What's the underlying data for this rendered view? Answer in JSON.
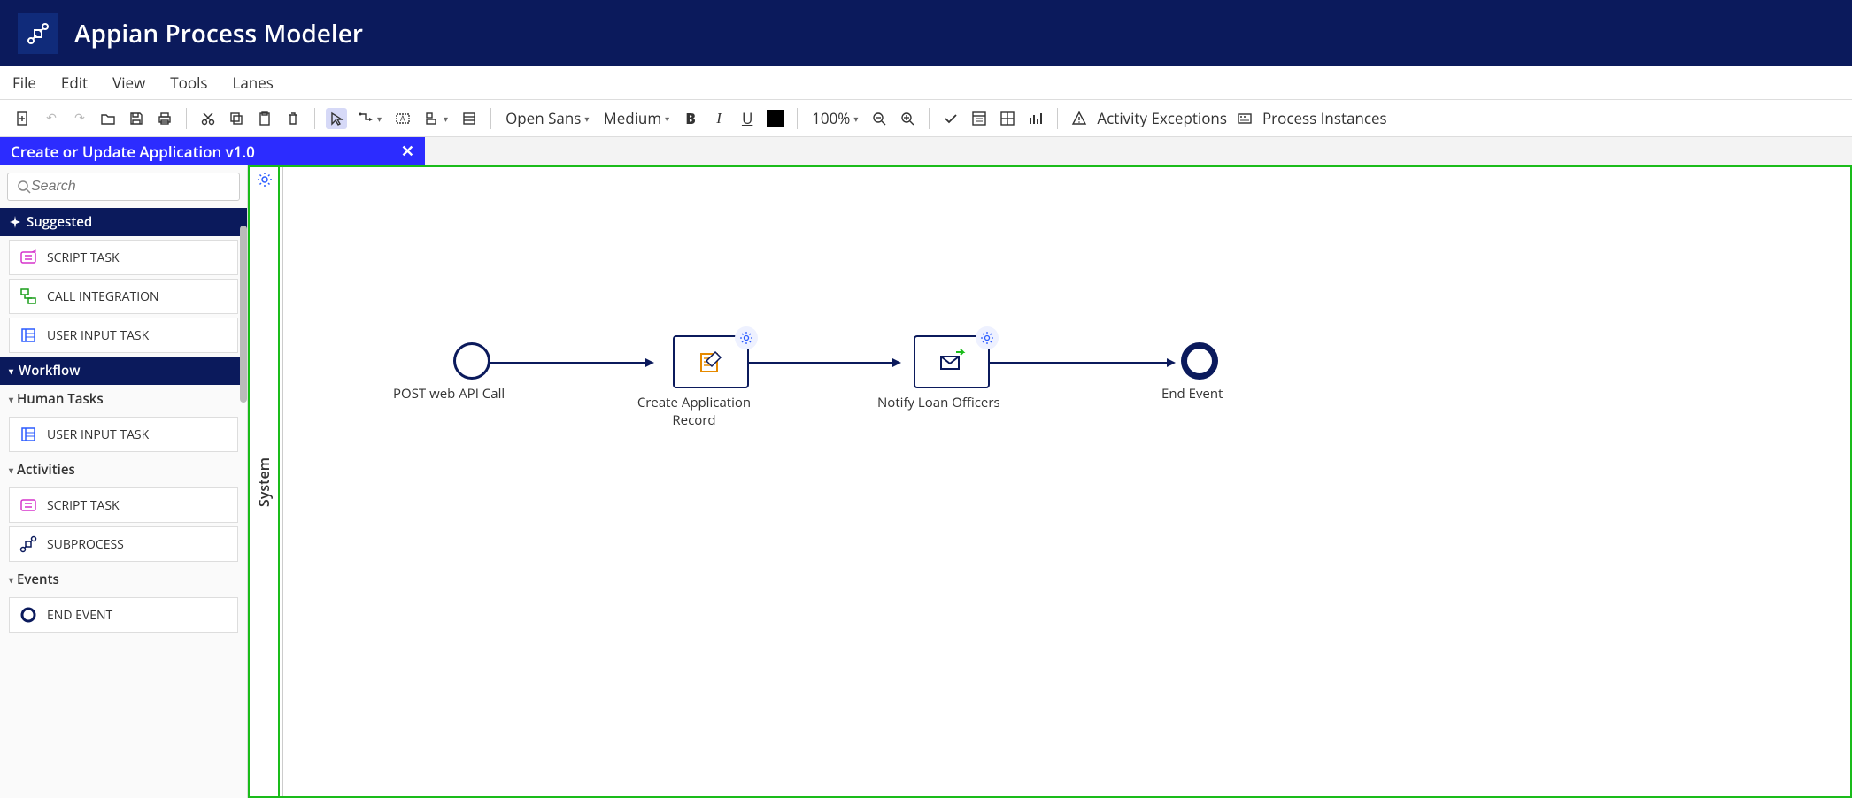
{
  "app_title": "Appian Process Modeler",
  "menu": [
    "File",
    "Edit",
    "View",
    "Tools",
    "Lanes"
  ],
  "toolbar": {
    "font_family": "Open Sans",
    "font_weight": "Medium",
    "zoom": "100%",
    "activity_exceptions": "Activity Exceptions",
    "process_instances": "Process Instances"
  },
  "tab_title": "Create or Update Application v1.0",
  "search_placeholder": "Search",
  "sidebar": {
    "suggested_label": "Suggested",
    "workflow_label": "Workflow",
    "suggested_items": [
      {
        "label": "SCRIPT TASK",
        "icon": "script"
      },
      {
        "label": "CALL INTEGRATION",
        "icon": "integration"
      },
      {
        "label": "USER INPUT TASK",
        "icon": "userinput"
      }
    ],
    "workflow_groups": [
      {
        "label": "Human Tasks",
        "items": [
          {
            "label": "USER INPUT TASK",
            "icon": "userinput"
          }
        ]
      },
      {
        "label": "Activities",
        "items": [
          {
            "label": "SCRIPT TASK",
            "icon": "script"
          },
          {
            "label": "SUBPROCESS",
            "icon": "subprocess"
          }
        ]
      },
      {
        "label": "Events",
        "items": [
          {
            "label": "END EVENT",
            "icon": "endcircle"
          }
        ]
      }
    ]
  },
  "swimlane_label": "System",
  "nodes": {
    "start": "POST web API Call",
    "task1": "Create Application Record",
    "task2": "Notify Loan Officers",
    "end": "End Event"
  }
}
